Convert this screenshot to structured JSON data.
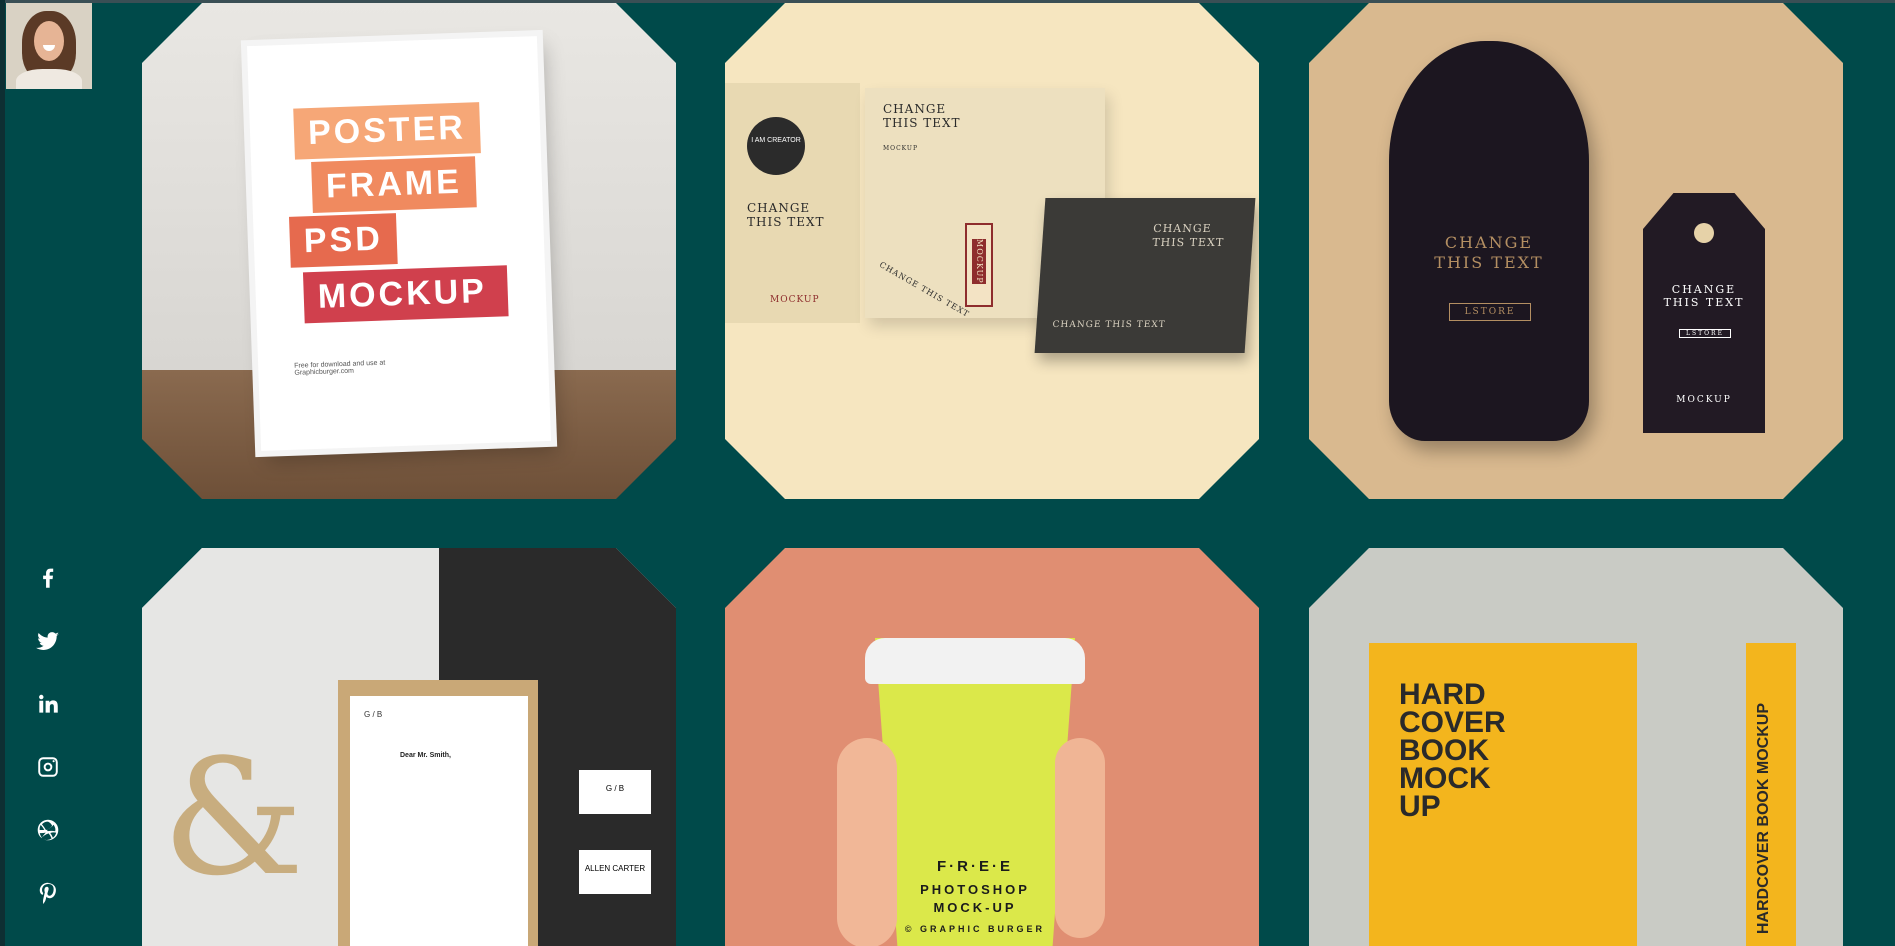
{
  "colors": {
    "background": "#004a4a",
    "icon": "#ffffff"
  },
  "profile": {
    "avatar_icon": "avatar-photo"
  },
  "social": [
    {
      "name": "facebook-icon",
      "label": "f"
    },
    {
      "name": "twitter-icon",
      "label": ""
    },
    {
      "name": "linkedin-icon",
      "label": "in"
    },
    {
      "name": "instagram-icon",
      "label": ""
    },
    {
      "name": "dribbble-icon",
      "label": ""
    },
    {
      "name": "pinterest-icon",
      "label": ""
    }
  ],
  "gallery": {
    "poster": {
      "lines": [
        "POSTER",
        "FRAME",
        "PSD",
        "MOCKUP"
      ],
      "note": "Free for download and use at Graphicburger.com"
    },
    "kraft": {
      "box_title": "CHANGE\nTHIS TEXT",
      "box_sub": "MOCKUP",
      "seal": "I AM CREATOR",
      "bag_text": "CHANGE\nTHIS TEXT",
      "bag_sub": "MOCKUP",
      "tag_text": "MOCKUP",
      "small_tag": "CHANGE THIS TEXT",
      "black_box_lid": "CHANGE\nTHIS TEXT",
      "black_box_front": "CHANGE THIS TEXT"
    },
    "bag": {
      "sack_title": "CHANGE\nTHIS TEXT",
      "sack_logo": "LSTORE",
      "tag_title": "CHANGE\nTHIS TEXT",
      "tag_logo": "LSTORE",
      "tag_sub": "MOCKUP"
    },
    "stationery": {
      "monogram": "G / B",
      "greeting": "Dear Mr. Smith,",
      "card_name": "ALLEN CARTER"
    },
    "cup": {
      "line1": "F·R·E·E",
      "line2": "PHOTOSHOP",
      "line3": "MOCK-UP",
      "line4": "© GRAPHIC BURGER"
    },
    "book": {
      "title": "HARD\nCOVER\nBOOK\nMOCK\nUP",
      "spine": "HARDCOVER BOOK MOCKUP"
    }
  }
}
